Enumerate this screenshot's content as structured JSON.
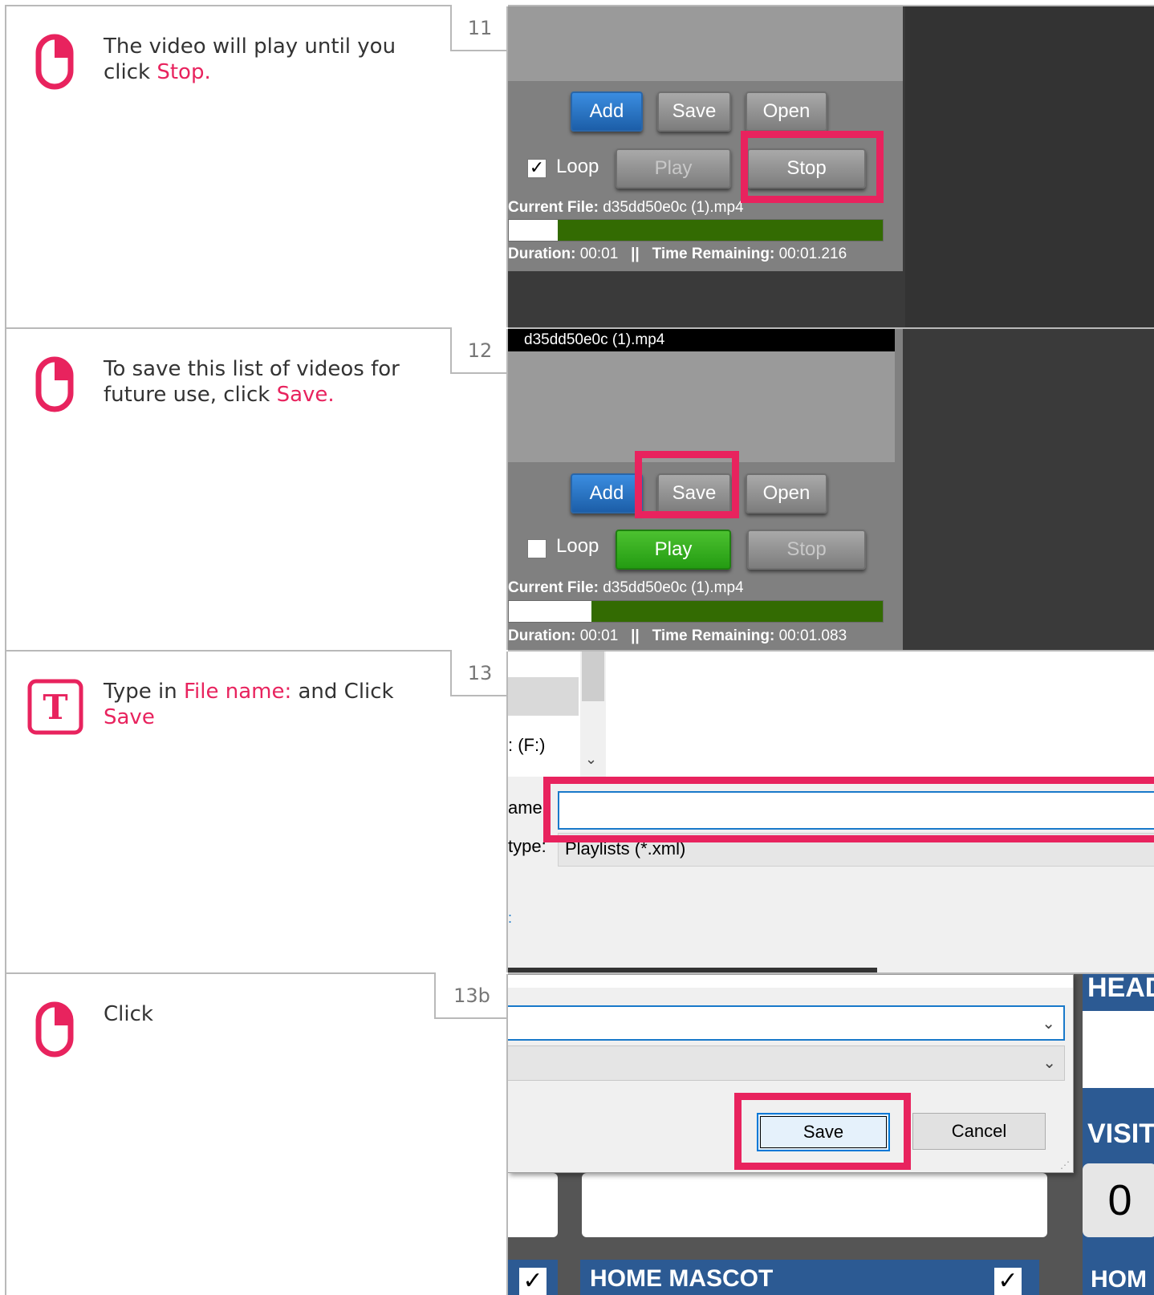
{
  "steps": [
    {
      "number": "11",
      "icon": "mouse-icon",
      "text_before": "The video will play until you click ",
      "highlight": "Stop.",
      "text_after": "",
      "screen": {
        "add_label": "Add",
        "save_label": "Save",
        "open_label": "Open",
        "loop_label": "Loop",
        "loop_checked": true,
        "play_label": "Play",
        "stop_label": "Stop",
        "current_file_label": "Current File:",
        "current_file_value": "d35dd50e0c (1).mp4",
        "progress_fraction": 0.13,
        "duration_label": "Duration:",
        "duration_value": "00:01",
        "separator": "||",
        "remaining_label": "Time Remaining:",
        "remaining_value": "00:01.216"
      }
    },
    {
      "number": "12",
      "icon": "mouse-icon",
      "text_before": "To save this list of videos for future use, click ",
      "highlight": "Save.",
      "text_after": "",
      "screen": {
        "list_item": "d35dd50e0c (1).mp4",
        "add_label": "Add",
        "save_label": "Save",
        "open_label": "Open",
        "loop_label": "Loop",
        "loop_checked": false,
        "play_label": "Play",
        "stop_label": "Stop",
        "current_file_label": "Current File:",
        "current_file_value": "d35dd50e0c (1).mp4",
        "progress_fraction": 0.22,
        "duration_label": "Duration:",
        "duration_value": "00:01",
        "separator": "||",
        "remaining_label": "Time Remaining:",
        "remaining_value": "00:01.083"
      }
    },
    {
      "number": "13",
      "icon": "type-icon",
      "icon_letter": "T",
      "text_before": "Type in ",
      "highlight": "File name:",
      "text_middle": " and Click ",
      "highlight2": "Save",
      "screen": {
        "drive_label": ": (F:)",
        "file_name_label": "ame:",
        "file_name_value": "",
        "type_label": "type:",
        "type_value": "Playlists (*.xml)",
        "left_glyph": ":"
      }
    },
    {
      "number": "13b",
      "icon": "mouse-icon",
      "text_before": "Click",
      "screen": {
        "save_label": "Save",
        "cancel_label": "Cancel",
        "heading_fragment": "HEAD",
        "visitor_fragment": "VISIT",
        "score_value": "0",
        "home_mascot_label": "HOME MASCOT",
        "home_fragment": "HOM"
      }
    }
  ],
  "colors": {
    "accent": "#e8235e",
    "border": "#b9b9b9",
    "progress": "#336b02"
  }
}
